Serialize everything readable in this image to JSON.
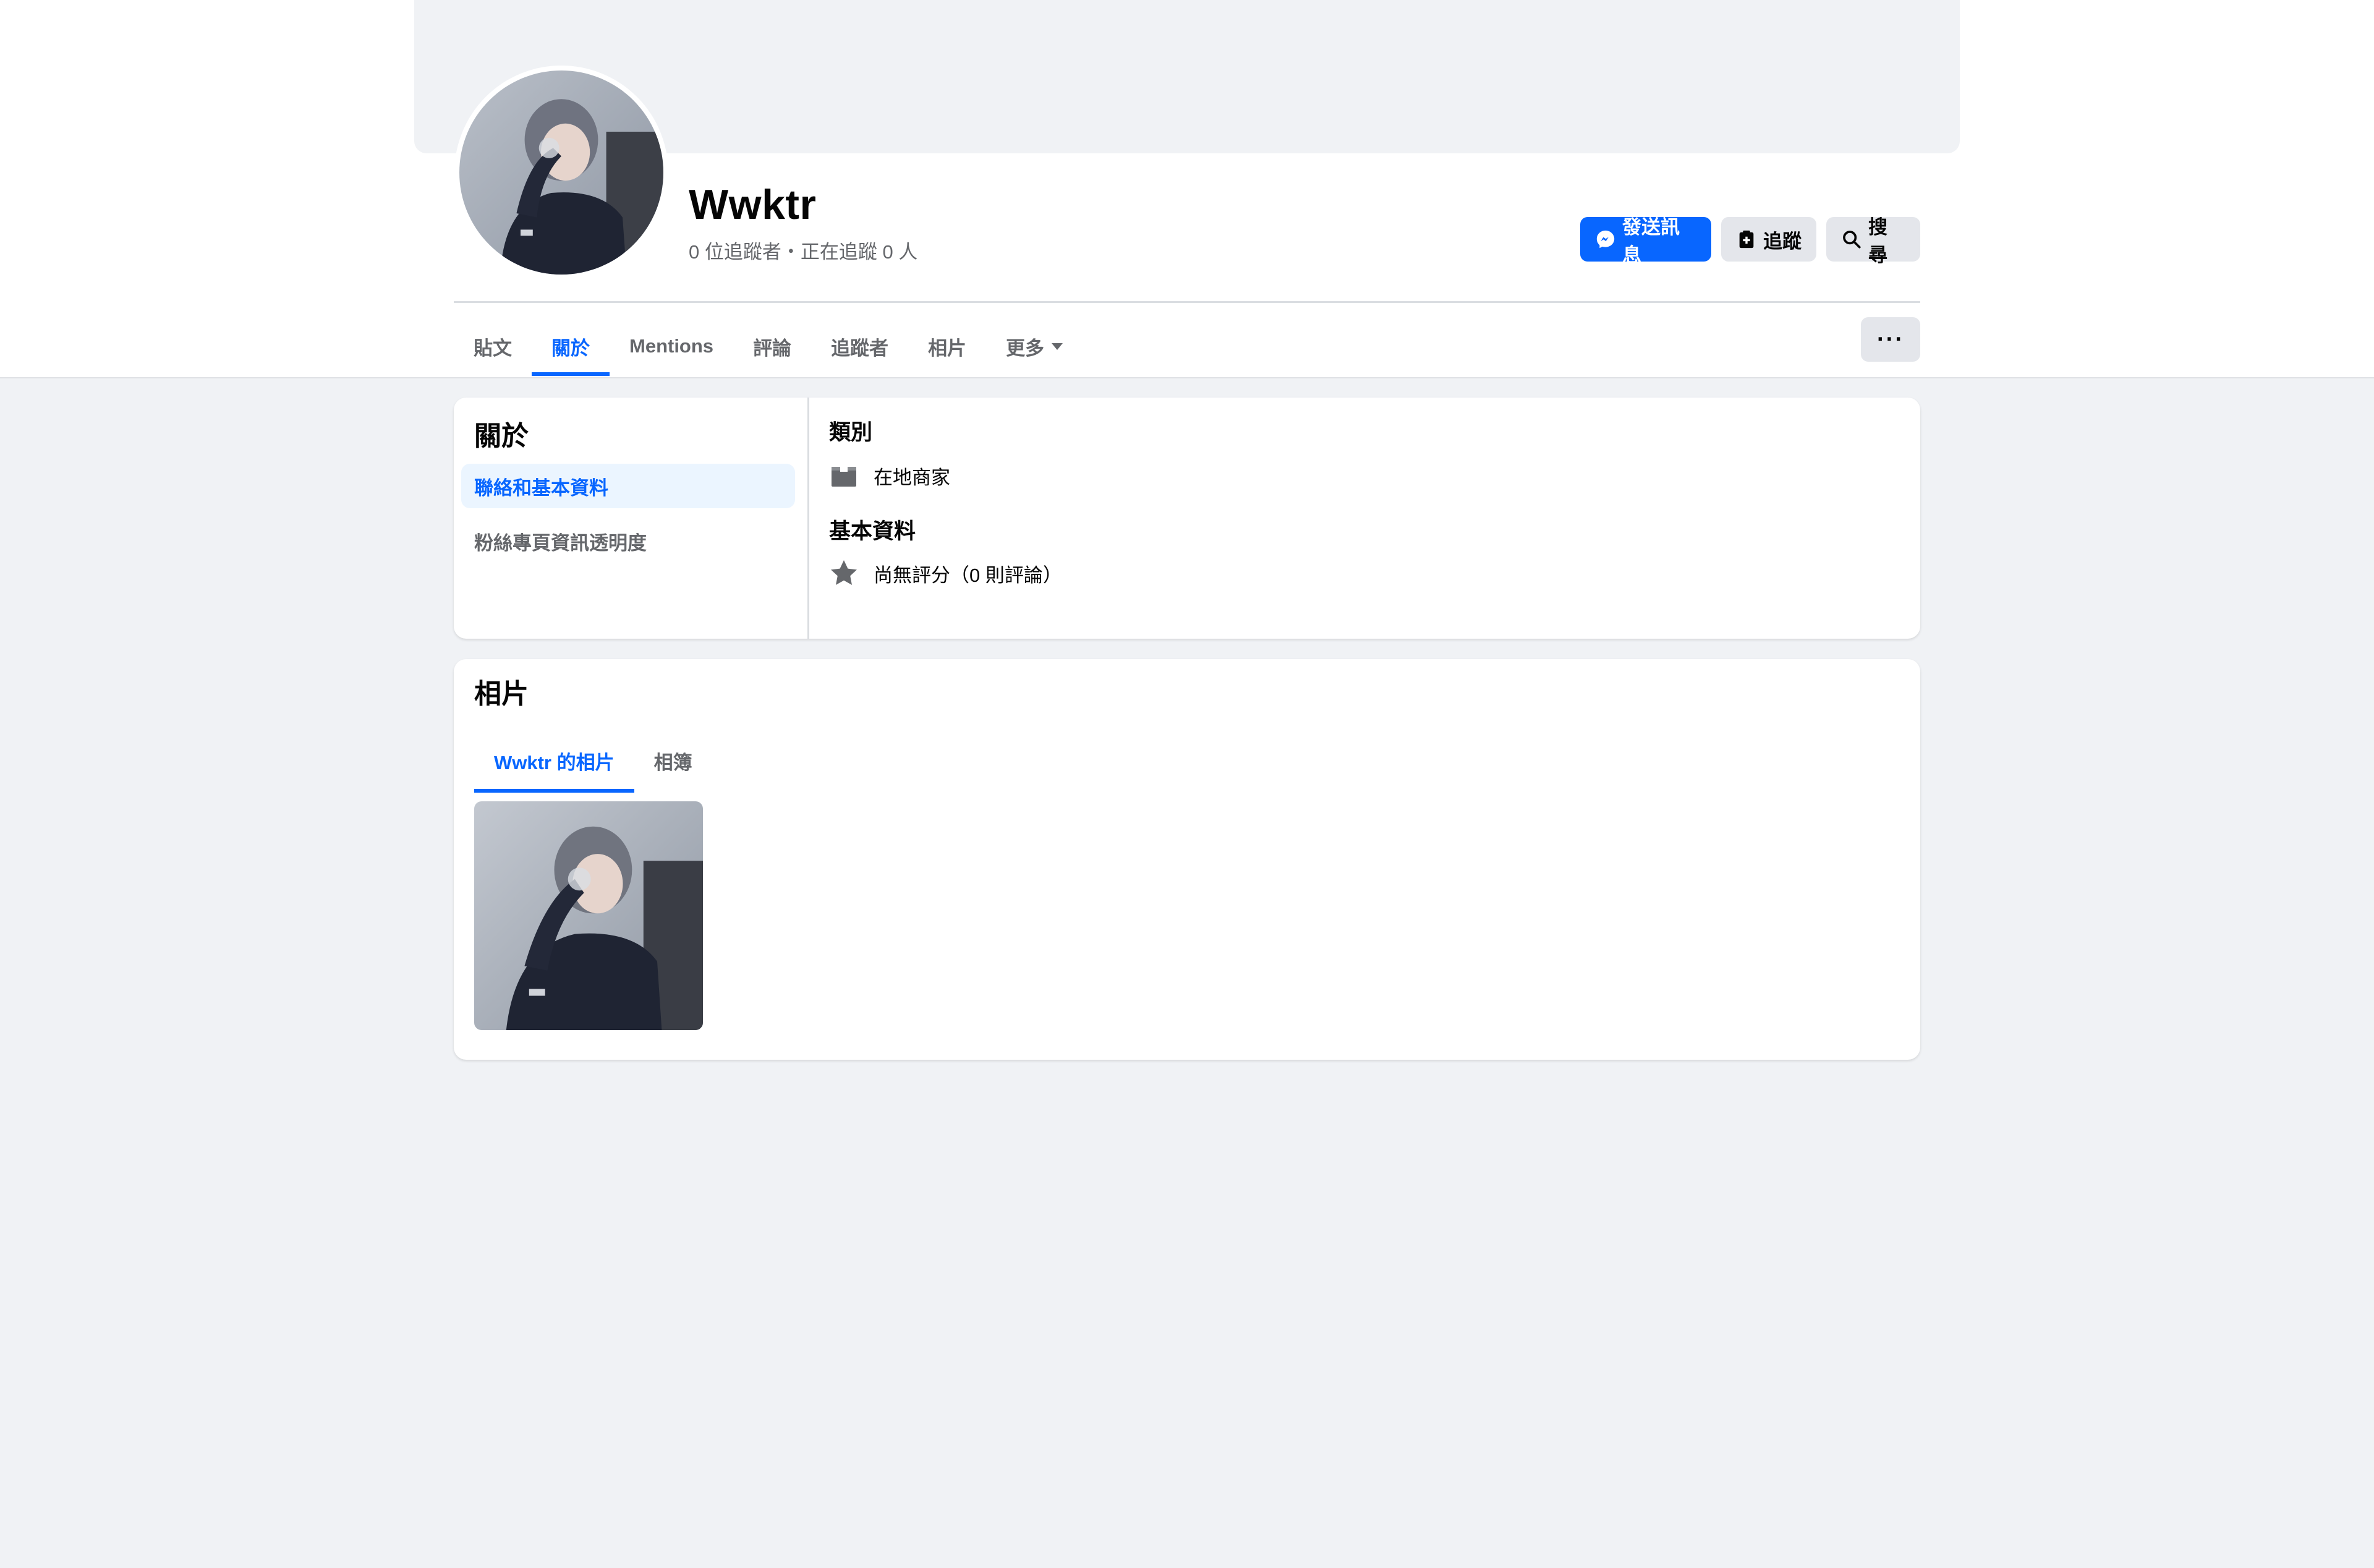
{
  "profile": {
    "name": "Wwktr",
    "stats": "0 位追蹤者・正在追蹤 0 人"
  },
  "actions": {
    "message_label": "發送訊息",
    "follow_label": "追蹤",
    "search_label": "搜尋"
  },
  "tabs": [
    {
      "label": "貼文"
    },
    {
      "label": "關於",
      "active": true
    },
    {
      "label": "Mentions"
    },
    {
      "label": "評論"
    },
    {
      "label": "追蹤者"
    },
    {
      "label": "相片"
    },
    {
      "label": "更多"
    }
  ],
  "more_button_label": "···",
  "about": {
    "title": "關於",
    "side_items": [
      {
        "label": "聯絡和基本資料",
        "active": true
      },
      {
        "label": "粉絲專頁資訊透明度"
      }
    ],
    "category_heading": "類別",
    "category_value": "在地商家",
    "basic_heading": "基本資料",
    "rating_value": "尚無評分（0 則評論）"
  },
  "photos": {
    "title": "相片",
    "tabs": [
      {
        "label": "Wwktr 的相片",
        "active": true
      },
      {
        "label": "相簿"
      }
    ]
  },
  "colors": {
    "accent": "#0866ff",
    "page_bg": "#f0f2f5",
    "secondary_button": "#e4e6eb",
    "muted_text": "#65676b"
  },
  "icons": [
    "messenger-icon",
    "follow-icon",
    "search-icon",
    "caret-down-icon",
    "category-icon",
    "star-icon"
  ]
}
